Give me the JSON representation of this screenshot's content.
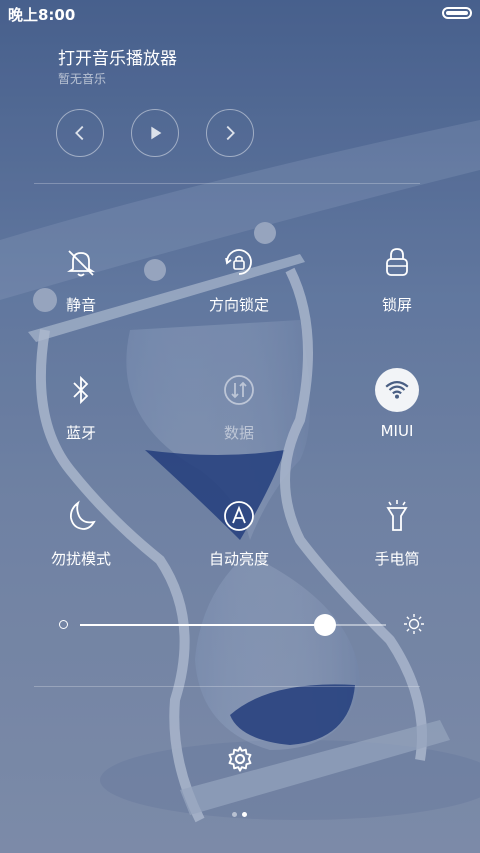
{
  "status_bar": {
    "time": "晚上8:00"
  },
  "music": {
    "title": "打开音乐播放器",
    "subtitle": "暂无音乐",
    "controls": [
      {
        "name": "previous-button",
        "icon": "chevron-left-icon"
      },
      {
        "name": "play-button",
        "icon": "play-icon"
      },
      {
        "name": "next-button",
        "icon": "chevron-right-icon"
      }
    ]
  },
  "toggles": [
    {
      "label": "静音",
      "icon": "bell-off-icon",
      "active": false
    },
    {
      "label": "方向锁定",
      "icon": "rotation-lock-icon",
      "active": false
    },
    {
      "label": "锁屏",
      "icon": "lock-icon",
      "active": false
    },
    {
      "label": "蓝牙",
      "icon": "bluetooth-icon",
      "active": false
    },
    {
      "label": "数据",
      "icon": "mobile-data-icon",
      "active": false
    },
    {
      "label": "MIUI",
      "icon": "wifi-icon",
      "active": true
    },
    {
      "label": "勿扰模式",
      "icon": "moon-icon",
      "active": false
    },
    {
      "label": "自动亮度",
      "icon": "auto-brightness-icon",
      "active": false
    },
    {
      "label": "手电筒",
      "icon": "flashlight-icon",
      "active": false
    }
  ],
  "brightness": {
    "value": 0.8
  },
  "pager": {
    "pages": 2,
    "current": 1
  },
  "colors": {
    "accent_active_bg": "#f2f4f7",
    "wifi_icon": "#4a5f84"
  }
}
